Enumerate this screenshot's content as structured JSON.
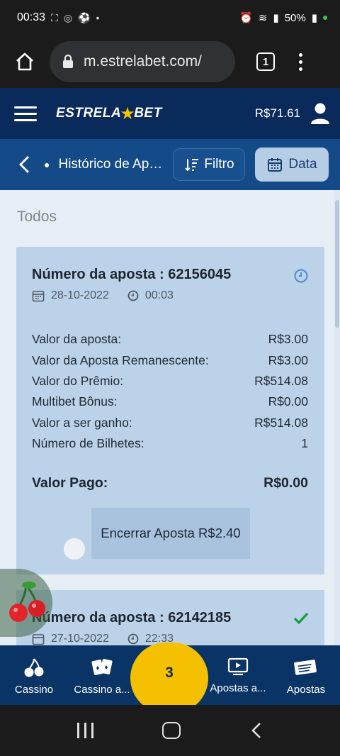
{
  "status_bar": {
    "time": "00:33",
    "battery": "50%",
    "icons": [
      "alarm-icon",
      "wifi-icon",
      "volte-icon",
      "signal-icon",
      "battery-icon"
    ]
  },
  "browser": {
    "url": "m.estrelabet.com/",
    "tab_count": "1"
  },
  "site_header": {
    "logo_left": "ESTRELA",
    "logo_right": "BET",
    "balance": "R$71.61"
  },
  "subheader": {
    "title": "Histórico de Apostas",
    "filter_label": "Filtro",
    "date_label": "Data"
  },
  "content": {
    "filter_heading": "Todos"
  },
  "bets": [
    {
      "title": "Número da aposta : 62156045",
      "date": "28-10-2022",
      "time": "00:03",
      "status_icon": "clock-icon",
      "rows": [
        {
          "label": "Valor da aposta:",
          "value": "R$3.00"
        },
        {
          "label": "Valor da Aposta Remanescente:",
          "value": "R$3.00"
        },
        {
          "label": "Valor do Prêmio:",
          "value": "R$514.08"
        },
        {
          "label": "Multibet Bônus:",
          "value": "R$0.00"
        },
        {
          "label": "Valor a ser ganho:",
          "value": "R$514.08"
        },
        {
          "label": "Número de Bilhetes:",
          "value": "1"
        }
      ],
      "paid_label": "Valor Pago:",
      "paid_value": "R$0.00",
      "cashout_label": "Encerrar Aposta R$2.40"
    },
    {
      "title": "Número da aposta : 62142185",
      "date": "27-10-2022",
      "time": "22:33",
      "status_icon": "check-icon"
    }
  ],
  "bottom_nav": {
    "items": [
      {
        "label": "Cassino",
        "icon": "cherry-icon"
      },
      {
        "label": "Cassino a...",
        "icon": "cards-icon"
      },
      {
        "label": "3",
        "icon": ""
      },
      {
        "label": "Apostas a...",
        "icon": "play-screen-icon"
      },
      {
        "label": "Apostas",
        "icon": "ticket-icon"
      }
    ]
  },
  "colors": {
    "header_bg": "#0a2a5c",
    "subheader_bg": "#144a88",
    "card_bg": "#bcd2e9",
    "accent_yellow": "#f5c000",
    "check_green": "#1a9a3a"
  }
}
